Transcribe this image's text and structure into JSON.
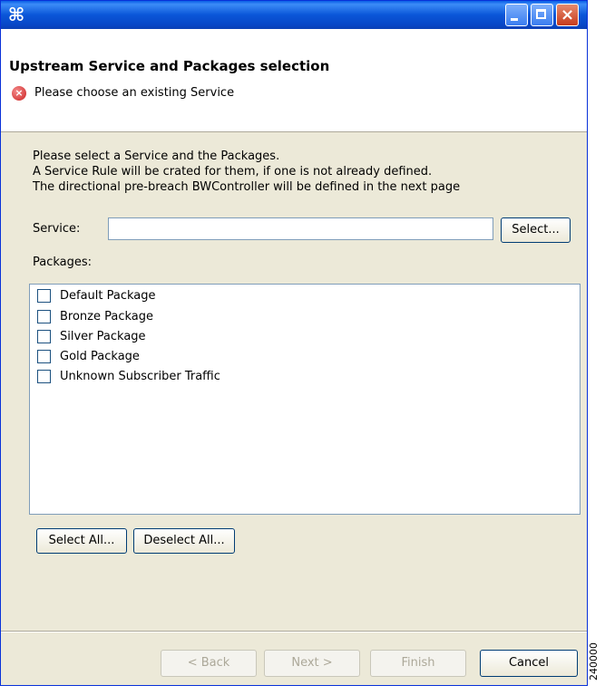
{
  "window": {
    "app_icon": "⌘",
    "close_glyph": "×"
  },
  "header": {
    "title": "Upstream Service and Packages selection",
    "error_message": "Please choose an existing Service",
    "error_icon_glyph": "×"
  },
  "intro": {
    "line1": "Please select a Service and the Packages.",
    "line2": "A Service Rule will be crated for them, if one is not already defined.",
    "line3": "The directional pre-breach BWController will be defined in the next page"
  },
  "service": {
    "label": "Service:",
    "value": "",
    "select_button": "Select..."
  },
  "packages": {
    "label": "Packages:",
    "items": [
      {
        "label": "Default Package",
        "checked": false
      },
      {
        "label": "Bronze Package",
        "checked": false
      },
      {
        "label": "Silver Package",
        "checked": false
      },
      {
        "label": "Gold Package",
        "checked": false
      },
      {
        "label": "Unknown Subscriber Traffic",
        "checked": false
      }
    ],
    "select_all": "Select All...",
    "deselect_all": "Deselect All..."
  },
  "footer": {
    "back": "< Back",
    "next": "Next >",
    "finish": "Finish",
    "cancel": "Cancel"
  },
  "figure_id": "240000"
}
